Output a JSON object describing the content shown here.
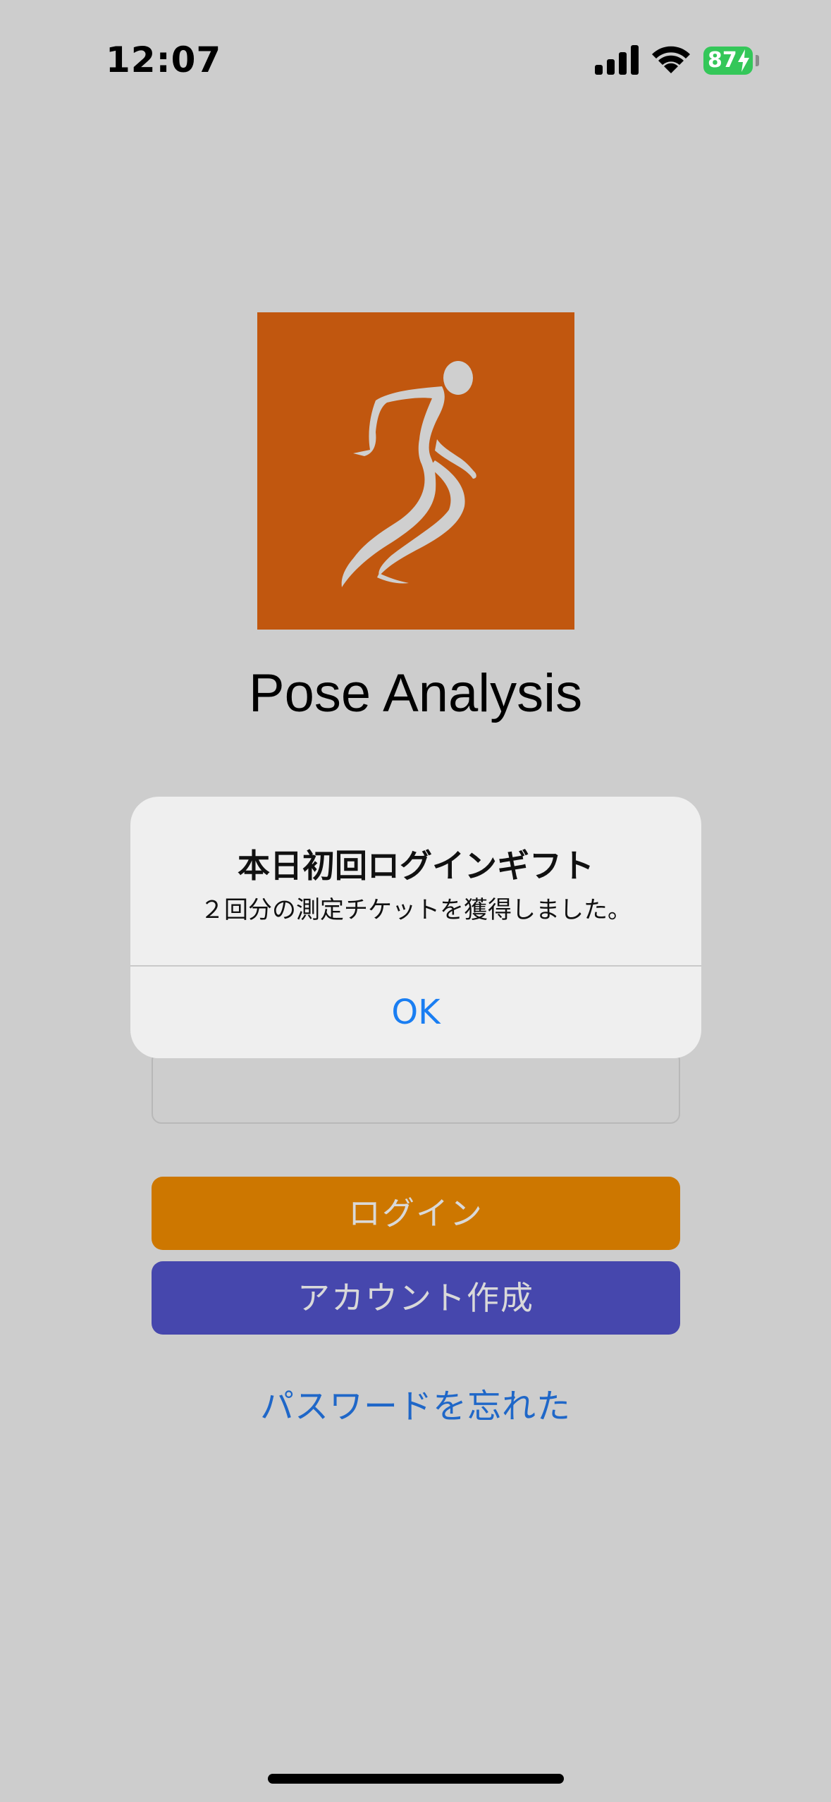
{
  "status_bar": {
    "time": "12:07",
    "battery_level": "87",
    "icons": [
      "signal-icon",
      "wifi-icon",
      "battery-charging-icon"
    ]
  },
  "app": {
    "title": "Pose Analysis",
    "logo_color": "#c1570f"
  },
  "alert": {
    "title": "本日初回ログインギフト",
    "message": "２回分の測定チケットを獲得しました。",
    "ok_label": "OK"
  },
  "form": {
    "login_label": "ログイン",
    "create_account_label": "アカウント作成",
    "forgot_password_label": "パスワードを忘れた"
  },
  "colors": {
    "background": "#cdcdcd",
    "login_button": "#cd7700",
    "create_button": "#4647ad",
    "link": "#1f67c8",
    "accent": "#1a7ef2"
  }
}
